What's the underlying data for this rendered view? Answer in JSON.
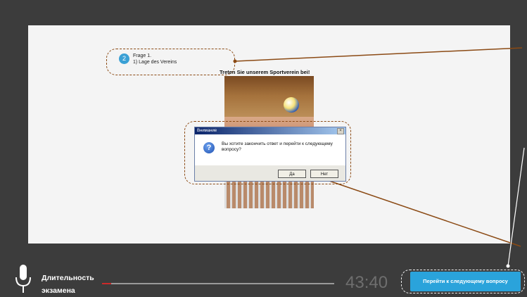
{
  "question": {
    "number": "2",
    "label": "Frage 1.",
    "sub": "1) Lage des Vereins"
  },
  "exercise": {
    "title": "Treten Sie unserem Sportverein bei!"
  },
  "dialog": {
    "title": "Внимание",
    "close": "×",
    "message": "Вы хотите закончить ответ и перейти к следующему вопросу?",
    "yes": "Да",
    "no": "Нет",
    "icon": "question-icon"
  },
  "footer": {
    "duration_label_1": "Длительность",
    "duration_label_2": "экзамена",
    "timer": "43:40",
    "progress_fraction": 0.04,
    "next_button": "Перейти к следующему вопросу"
  },
  "colors": {
    "accent": "#2aa3db",
    "callout": "#8b4a14",
    "progress": "#cc2a2a",
    "background": "#3c3c3c"
  }
}
